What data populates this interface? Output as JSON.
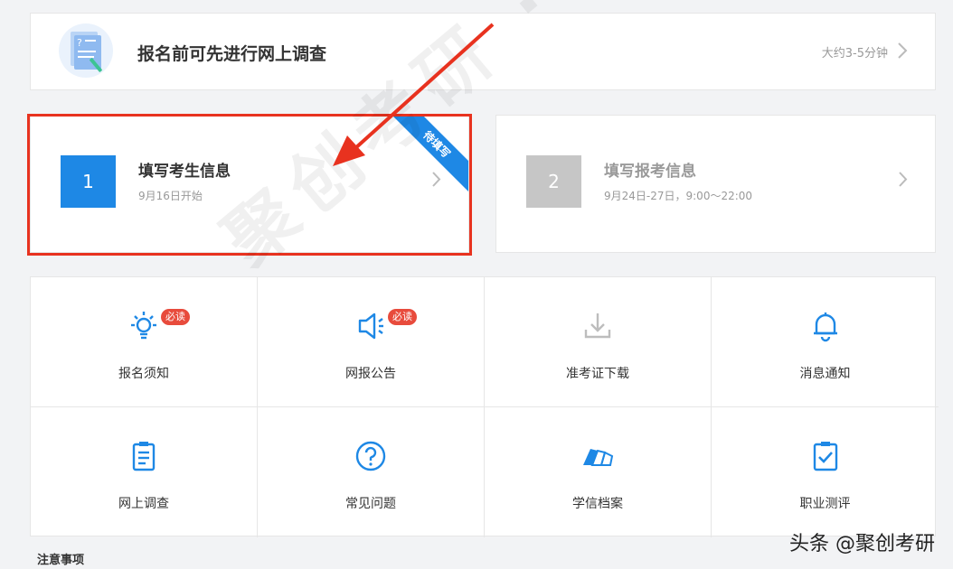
{
  "survey": {
    "title": "报名前可先进行网上调查",
    "duration": "大约3-5分钟"
  },
  "steps": [
    {
      "number": "1",
      "title": "填写考生信息",
      "subtitle": "9月16日开始",
      "ribbon": "待填写"
    },
    {
      "number": "2",
      "title": "填写报考信息",
      "subtitle": "9月24日-27日，9:00～22:00"
    }
  ],
  "tiles": [
    {
      "label": "报名须知",
      "icon": "lightbulb-icon",
      "badge": "必读"
    },
    {
      "label": "网报公告",
      "icon": "megaphone-icon",
      "badge": "必读"
    },
    {
      "label": "准考证下载",
      "icon": "download-icon"
    },
    {
      "label": "消息通知",
      "icon": "bell-icon"
    },
    {
      "label": "网上调查",
      "icon": "survey-clipboard-icon"
    },
    {
      "label": "常见问题",
      "icon": "question-circle-icon"
    },
    {
      "label": "学信档案",
      "icon": "books-icon"
    },
    {
      "label": "职业测评",
      "icon": "checklist-clipboard-icon"
    }
  ],
  "notice_title": "注意事项",
  "watermark": "聚创考研 · 公众号",
  "footer_credit": "头条 @聚创考研",
  "colors": {
    "accent": "#1e88e5",
    "highlight": "#e8321f",
    "badge": "#e84b3c"
  }
}
